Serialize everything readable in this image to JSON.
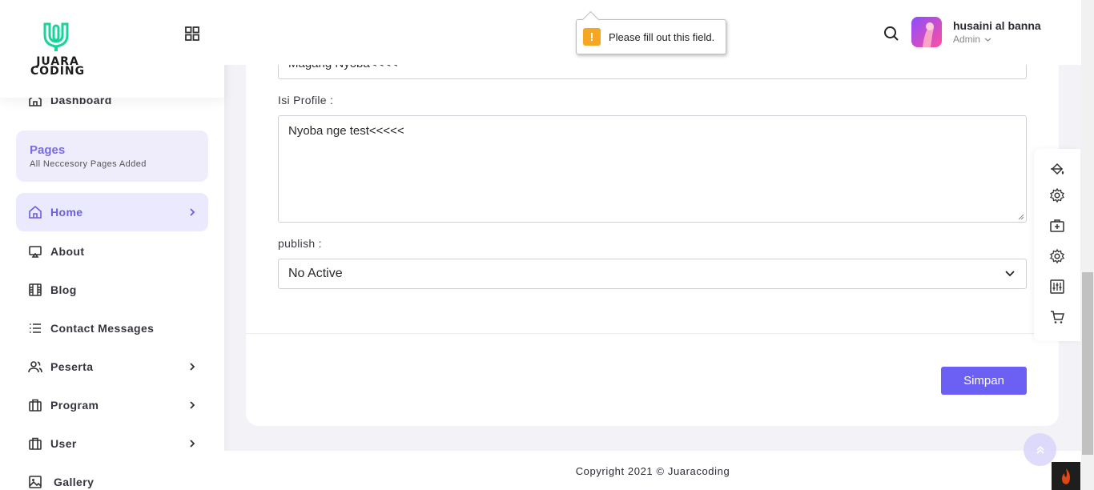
{
  "brand": {
    "logo_text_line1": "JUARA",
    "logo_text_line2": "CODING",
    "accent": "#6c5ff3",
    "logo_color": "#17d49b"
  },
  "sidebar": {
    "dashboard_label": "Dashboard",
    "pages_box": {
      "title": "Pages",
      "subtitle": "All Neccesory Pages Added"
    },
    "items": [
      {
        "label": "Home",
        "icon": "home-icon",
        "active": true,
        "has_submenu": true
      },
      {
        "label": "About",
        "icon": "monitor-icon",
        "active": false,
        "has_submenu": false
      },
      {
        "label": "Blog",
        "icon": "film-icon",
        "active": false,
        "has_submenu": false
      },
      {
        "label": "Contact Messages",
        "icon": "list-icon",
        "active": false,
        "has_submenu": false
      },
      {
        "label": "Peserta",
        "icon": "users-icon",
        "active": false,
        "has_submenu": true
      },
      {
        "label": "Program",
        "icon": "briefcase-icon",
        "active": false,
        "has_submenu": true
      },
      {
        "label": "User",
        "icon": "briefcase-icon",
        "active": false,
        "has_submenu": true
      },
      {
        "label": "Gallery",
        "icon": "image-icon",
        "active": false,
        "has_submenu": false
      }
    ]
  },
  "header": {
    "user_name": "husaini al banna",
    "user_role": "Admin"
  },
  "tooltip": {
    "message": "Please fill out this field."
  },
  "form": {
    "title_value": "Magang Nyoba<<<<",
    "profile_label": "Isi Profile :",
    "profile_value": "Nyoba nge test<<<<<",
    "publish_label": "publish :",
    "publish_selected": "No Active",
    "submit_label": "Simpan"
  },
  "footer": {
    "copyright": "Copyright 2021 © Juaracoding"
  }
}
